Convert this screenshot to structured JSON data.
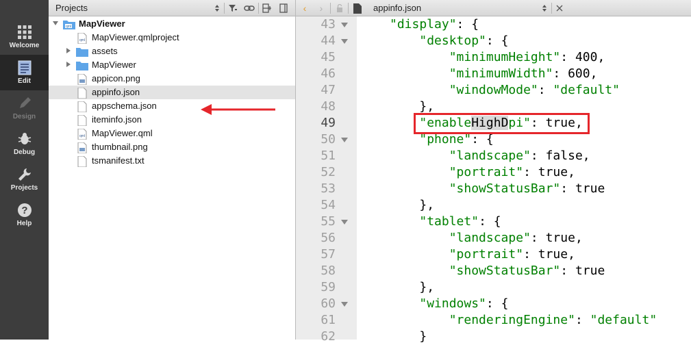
{
  "modes": [
    {
      "label": "Welcome",
      "icon": "grid-icon",
      "active": false,
      "disabled": false
    },
    {
      "label": "Edit",
      "icon": "document-icon",
      "active": true,
      "disabled": false
    },
    {
      "label": "Design",
      "icon": "pencil-icon",
      "active": false,
      "disabled": true
    },
    {
      "label": "Debug",
      "icon": "bug-icon",
      "active": false,
      "disabled": false
    },
    {
      "label": "Projects",
      "icon": "wrench-icon",
      "active": false,
      "disabled": false
    },
    {
      "label": "Help",
      "icon": "help-icon",
      "active": false,
      "disabled": false
    }
  ],
  "projects": {
    "title": "Projects",
    "tree": [
      {
        "label": "MapViewer",
        "icon": "qml-folder-icon",
        "bold": true,
        "expanded": true
      },
      {
        "label": "MapViewer.qmlproject",
        "icon": "qml-file-icon"
      },
      {
        "label": "assets",
        "icon": "folder-icon",
        "collapsed": true
      },
      {
        "label": "MapViewer",
        "icon": "folder-icon",
        "collapsed": true
      },
      {
        "label": "appicon.png",
        "icon": "image-file-icon"
      },
      {
        "label": "appinfo.json",
        "icon": "file-icon",
        "selected": true
      },
      {
        "label": "appschema.json",
        "icon": "file-icon"
      },
      {
        "label": "iteminfo.json",
        "icon": "file-icon"
      },
      {
        "label": "MapViewer.qml",
        "icon": "qml-file-icon"
      },
      {
        "label": "thumbnail.png",
        "icon": "image-file-icon"
      },
      {
        "label": "tsmanifest.txt",
        "icon": "file-icon"
      }
    ]
  },
  "editor": {
    "filename": "appinfo.json",
    "lines": [
      {
        "n": "43",
        "fold": true,
        "indent": "",
        "parts": [
          [
            "s",
            "\"display\""
          ],
          [
            "p",
            ": {"
          ]
        ]
      },
      {
        "n": "44",
        "fold": true,
        "indent": "    ",
        "parts": [
          [
            "s",
            "\"desktop\""
          ],
          [
            "p",
            ": {"
          ]
        ]
      },
      {
        "n": "45",
        "fold": false,
        "indent": "        ",
        "parts": [
          [
            "s",
            "\"minimumHeight\""
          ],
          [
            "p",
            ": 400,"
          ]
        ]
      },
      {
        "n": "46",
        "fold": false,
        "indent": "        ",
        "parts": [
          [
            "s",
            "\"minimumWidth\""
          ],
          [
            "p",
            ": 600,"
          ]
        ]
      },
      {
        "n": "47",
        "fold": false,
        "indent": "        ",
        "parts": [
          [
            "s",
            "\"windowMode\""
          ],
          [
            "p",
            ": "
          ],
          [
            "s",
            "\"default\""
          ]
        ]
      },
      {
        "n": "48",
        "fold": false,
        "indent": "    ",
        "parts": [
          [
            "p",
            "},"
          ]
        ]
      },
      {
        "n": "49",
        "fold": false,
        "current": true,
        "indent": "    ",
        "parts": [
          [
            "s",
            "\"enable"
          ],
          [
            "h",
            "HighD"
          ],
          [
            "s",
            "pi\""
          ],
          [
            "p",
            ": true,"
          ]
        ]
      },
      {
        "n": "50",
        "fold": true,
        "indent": "    ",
        "parts": [
          [
            "s",
            "\"phone\""
          ],
          [
            "p",
            ": {"
          ]
        ]
      },
      {
        "n": "51",
        "fold": false,
        "indent": "        ",
        "parts": [
          [
            "s",
            "\"landscape\""
          ],
          [
            "p",
            ": false,"
          ]
        ]
      },
      {
        "n": "52",
        "fold": false,
        "indent": "        ",
        "parts": [
          [
            "s",
            "\"portrait\""
          ],
          [
            "p",
            ": true,"
          ]
        ]
      },
      {
        "n": "53",
        "fold": false,
        "indent": "        ",
        "parts": [
          [
            "s",
            "\"showStatusBar\""
          ],
          [
            "p",
            ": true"
          ]
        ]
      },
      {
        "n": "54",
        "fold": false,
        "indent": "    ",
        "parts": [
          [
            "p",
            "},"
          ]
        ]
      },
      {
        "n": "55",
        "fold": true,
        "indent": "    ",
        "parts": [
          [
            "s",
            "\"tablet\""
          ],
          [
            "p",
            ": {"
          ]
        ]
      },
      {
        "n": "56",
        "fold": false,
        "indent": "        ",
        "parts": [
          [
            "s",
            "\"landscape\""
          ],
          [
            "p",
            ": true,"
          ]
        ]
      },
      {
        "n": "57",
        "fold": false,
        "indent": "        ",
        "parts": [
          [
            "s",
            "\"portrait\""
          ],
          [
            "p",
            ": true,"
          ]
        ]
      },
      {
        "n": "58",
        "fold": false,
        "indent": "        ",
        "parts": [
          [
            "s",
            "\"showStatusBar\""
          ],
          [
            "p",
            ": true"
          ]
        ]
      },
      {
        "n": "59",
        "fold": false,
        "indent": "    ",
        "parts": [
          [
            "p",
            "},"
          ]
        ]
      },
      {
        "n": "60",
        "fold": true,
        "indent": "    ",
        "parts": [
          [
            "s",
            "\"windows\""
          ],
          [
            "p",
            ": {"
          ]
        ]
      },
      {
        "n": "61",
        "fold": false,
        "indent": "        ",
        "parts": [
          [
            "s",
            "\"renderingEngine\""
          ],
          [
            "p",
            ": "
          ],
          [
            "s",
            "\"default\""
          ]
        ]
      },
      {
        "n": "62",
        "fold": false,
        "indent": "    ",
        "parts": [
          [
            "p",
            "}"
          ]
        ]
      }
    ]
  },
  "colors": {
    "accent_red": "#e5262b",
    "string_green": "#008000",
    "modebar": "#3d3d3d"
  }
}
